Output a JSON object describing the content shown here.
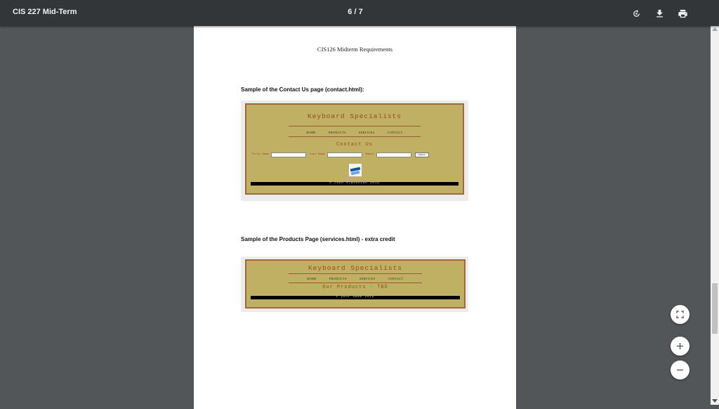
{
  "toolbar": {
    "title": "CIS 227 Mid-Term",
    "page_indicator": "6 / 7",
    "icons": [
      "rotate-icon",
      "download-icon",
      "print-icon"
    ]
  },
  "page": {
    "header": "CIS126 Midterm Requirements",
    "caption_contact": "Sample of the Contact Us page (contact.html):",
    "caption_products": "Sample of the Products Page (services.html) -  extra credit"
  },
  "contact_sample": {
    "title": "Keyboard Specialists",
    "nav": [
      "HOME",
      "PRODUCTS",
      "SERVICES",
      "CONTACT"
    ],
    "heading": "Contact Us",
    "form_labels": [
      "First Name",
      "Last Name",
      "Email"
    ],
    "submit_label": "Submit",
    "footer": "© John Slavonian 2019"
  },
  "products_sample": {
    "title": "Keyboard Specialists",
    "nav": [
      "HOME",
      "PRODUCTS",
      "SERVICES",
      "CONTACT"
    ],
    "heading": "Our Products - TBD",
    "footer": "© your name 2019"
  },
  "zoom_controls": [
    "fit-to-page-icon",
    "zoom-in-icon",
    "zoom-out-icon"
  ],
  "colors": {
    "toolbar_bg": "#323639",
    "viewer_bg": "#525659",
    "site_bg": "#bfb063",
    "site_border": "#a3673b",
    "site_title": "#9c4a1a"
  }
}
